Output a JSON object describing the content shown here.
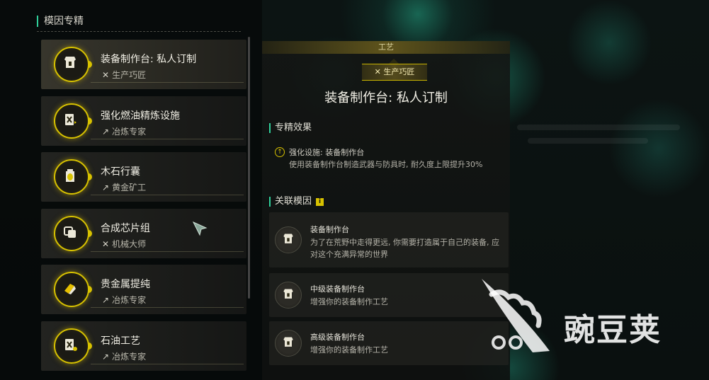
{
  "sidebar": {
    "section_title": "模因专精",
    "items": [
      {
        "name": "装备制作台: 私人订制",
        "tag": "生产巧匠",
        "tag_icon": "tools-icon",
        "icon": "armor-icon"
      },
      {
        "name": "强化燃油精炼设施",
        "tag": "冶炼专家",
        "tag_icon": "pickaxe-icon",
        "icon": "fuel-icon"
      },
      {
        "name": "木石行囊",
        "tag": "黄金矿工",
        "tag_icon": "pickaxe-icon",
        "icon": "backpack-icon"
      },
      {
        "name": "合成芯片组",
        "tag": "机械大师",
        "tag_icon": "tools-icon",
        "icon": "chip-icon"
      },
      {
        "name": "贵金属提纯",
        "tag": "冶炼专家",
        "tag_icon": "pickaxe-icon",
        "icon": "ingot-icon"
      },
      {
        "name": "石油工艺",
        "tag": "冶炼专家",
        "tag_icon": "pickaxe-icon",
        "icon": "oil-icon"
      }
    ]
  },
  "detail": {
    "category": "工艺",
    "badge": "生产巧匠",
    "title": "装备制作台: 私人订制",
    "effect_heading": "专精效果",
    "effect_title": "强化设施: 装备制作台",
    "effect_desc": "使用装备制作台制造武器与防具时, 耐久度上限提升30%",
    "related_heading": "关联模因",
    "related": [
      {
        "name": "装备制作台",
        "desc": "为了在荒野中走得更远, 你需要打造属于自己的装备, 应对这个充满异常的世界"
      },
      {
        "name": "中级装备制作台",
        "desc": "增强你的装备制作工艺"
      },
      {
        "name": "高级装备制作台",
        "desc": "增强你的装备制作工艺"
      }
    ]
  },
  "watermark": {
    "text": "豌豆荚"
  },
  "colors": {
    "accent_gold": "#d8c200",
    "accent_teal": "#2fcf9a"
  }
}
